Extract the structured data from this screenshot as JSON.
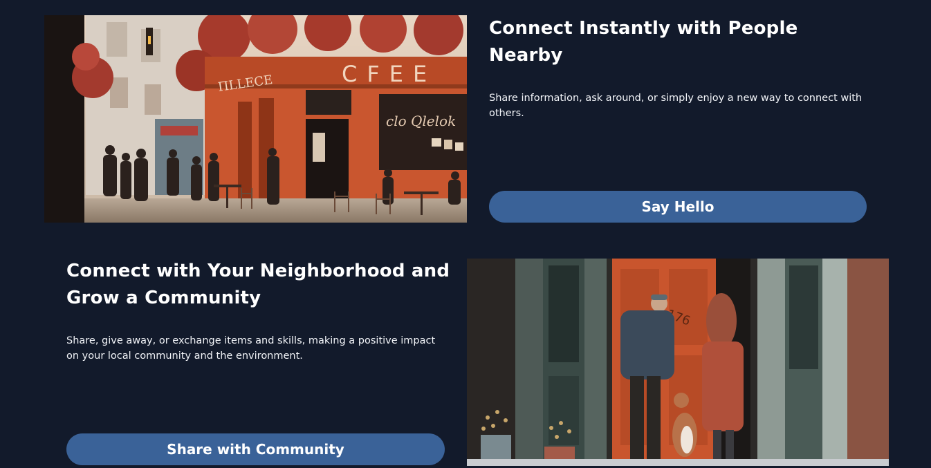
{
  "sections": [
    {
      "title": "Connect Instantly with People Nearby",
      "description": "Share information, ask around, or simply enjoy a new way to connect with others.",
      "button_label": "Say Hello",
      "image_sign_text": "CFEE",
      "image_awning_text": "ПLLECE"
    },
    {
      "title": "Connect with Your Neighborhood and Grow a Community",
      "description": "Share, give away, or exchange items and skills, making a positive impact on your local community and the environment.",
      "button_label": "Share with Community",
      "image_door_number": "176"
    }
  ],
  "colors": {
    "background": "#121a2b",
    "button": "#3a6298",
    "text": "#ffffff"
  }
}
